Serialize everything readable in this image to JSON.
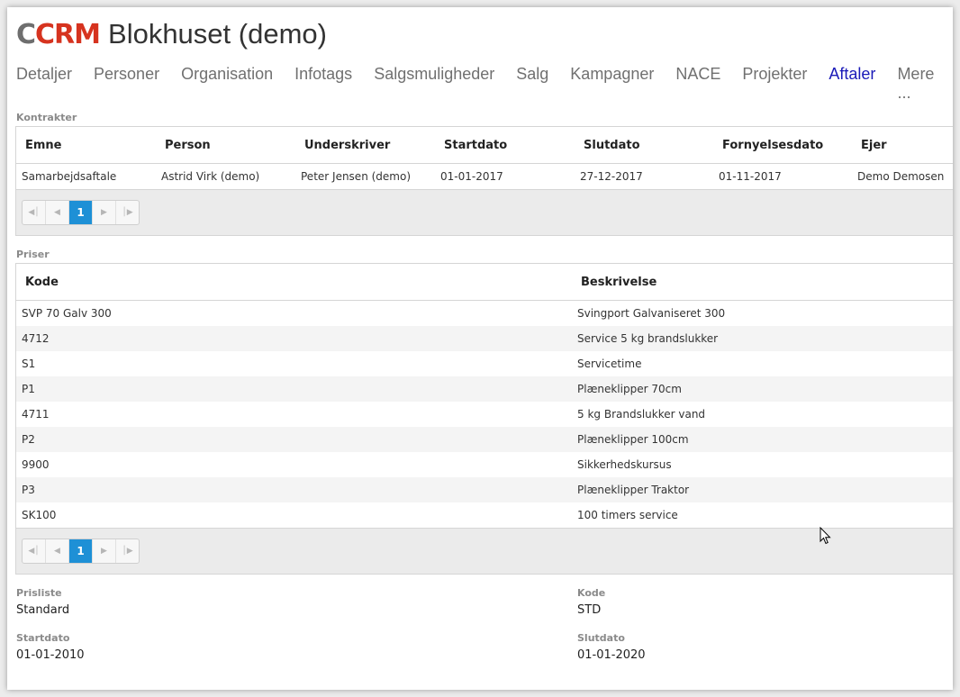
{
  "app": {
    "logo_c": "C",
    "logo_crm": "CRM",
    "title": "Blokhuset (demo)"
  },
  "nav": {
    "tabs": [
      "Detaljer",
      "Personer",
      "Organisation",
      "Infotags",
      "Salgsmuligheder",
      "Salg",
      "Kampagner",
      "NACE",
      "Projekter",
      "Aftaler",
      "Mere ..."
    ],
    "active": "Aftaler"
  },
  "kontrakter": {
    "label": "Kontrakter",
    "columns": [
      "Emne",
      "Person",
      "Underskriver",
      "Startdato",
      "Slutdato",
      "Fornyelsesdato",
      "Ejer"
    ],
    "rows": [
      [
        "Samarbejdsaftale",
        "Astrid Virk (demo)",
        "Peter Jensen (demo)",
        "01-01-2017",
        "27-12-2017",
        "01-11-2017",
        "Demo Demosen"
      ]
    ],
    "pager": {
      "first_icon": "first-page-icon",
      "prev_icon": "prev-page-icon",
      "current_page": "1",
      "next_icon": "next-page-icon",
      "last_icon": "last-page-icon"
    }
  },
  "priser": {
    "label": "Priser",
    "columns": [
      "Kode",
      "Beskrivelse"
    ],
    "rows": [
      [
        "SVP 70 Galv 300",
        "Svingport Galvaniseret 300"
      ],
      [
        "4712",
        "Service 5 kg brandslukker"
      ],
      [
        "S1",
        "Servicetime"
      ],
      [
        "P1",
        "Plæneklipper 70cm"
      ],
      [
        "4711",
        "5 kg Brandslukker vand"
      ],
      [
        "P2",
        "Plæneklipper 100cm"
      ],
      [
        "9900",
        "Sikkerhedskursus"
      ],
      [
        "P3",
        "Plæneklipper Traktor"
      ],
      [
        "SK100",
        "100 timers service"
      ]
    ],
    "pager": {
      "current_page": "1"
    }
  },
  "details": {
    "prisliste_label": "Prisliste",
    "prisliste_value": "Standard",
    "kode_label": "Kode",
    "kode_value": "STD",
    "startdato_label": "Startdato",
    "startdato_value": "01-01-2010",
    "slutdato_label": "Slutdato",
    "slutdato_value": "01-01-2020"
  },
  "colors": {
    "active_tab": "#1a1ab8",
    "logo_red": "#d6331f",
    "pager_current": "#1e90d6"
  }
}
